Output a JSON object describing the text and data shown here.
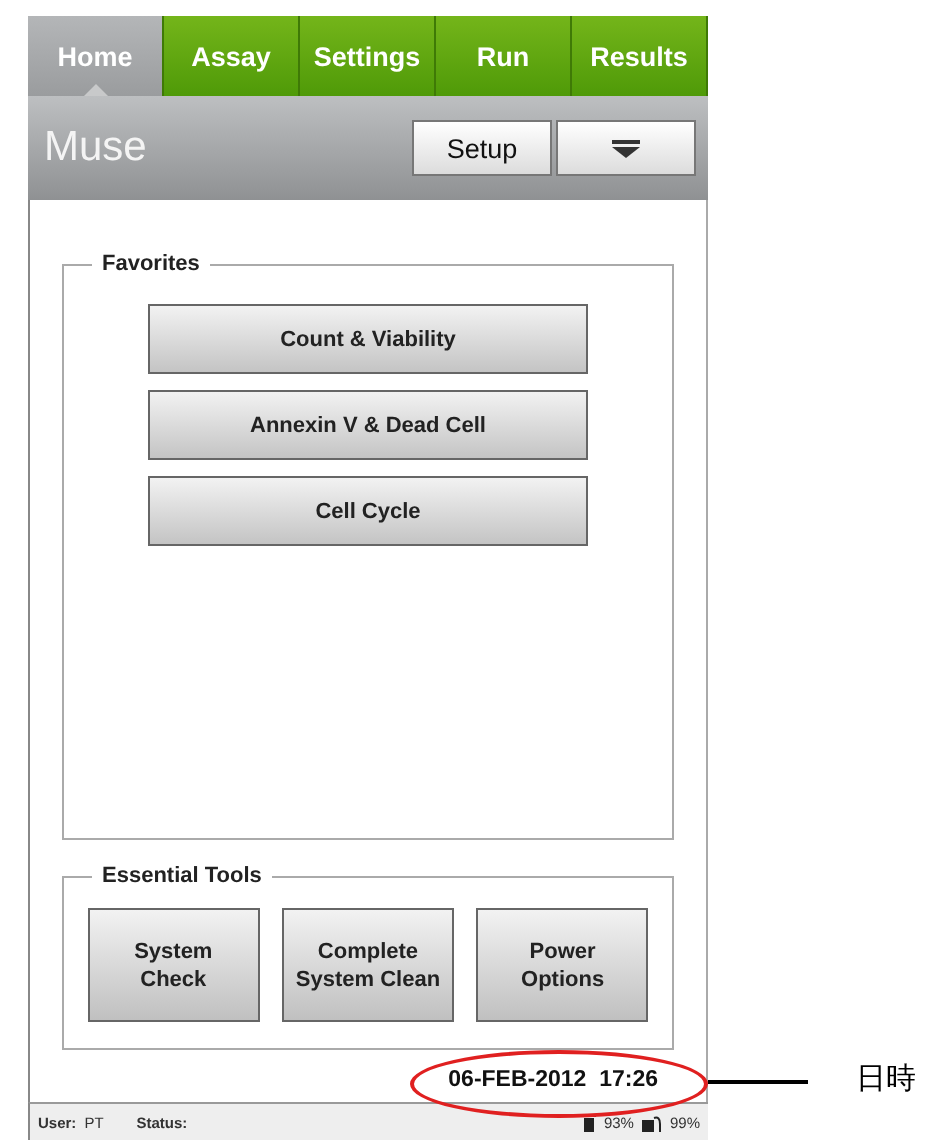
{
  "tabs": [
    {
      "label": "Home",
      "selected": true
    },
    {
      "label": "Assay",
      "selected": false
    },
    {
      "label": "Settings",
      "selected": false
    },
    {
      "label": "Run",
      "selected": false
    },
    {
      "label": "Results",
      "selected": false
    }
  ],
  "title_bar": {
    "title": "Muse",
    "buttons": [
      {
        "kind": "text",
        "label": "Setup"
      },
      {
        "kind": "menu"
      }
    ]
  },
  "favorites": {
    "title": "Favorites",
    "items": [
      "Count & Viability",
      "Annexin V & Dead Cell",
      "Cell Cycle"
    ]
  },
  "essential_tools": {
    "title": "Essential Tools",
    "items": [
      "System\nCheck",
      "Complete\nSystem Clean",
      "Power\nOptions"
    ]
  },
  "datetime": "06-FEB-2012  17:26",
  "status_bar": {
    "user_label": "User:",
    "user": "PT",
    "status_label": "Status:",
    "readings": [
      {
        "kind": "waste",
        "value": "93%"
      },
      {
        "kind": "reagent",
        "value": "99%"
      }
    ]
  },
  "annotation": {
    "label": "日時"
  }
}
